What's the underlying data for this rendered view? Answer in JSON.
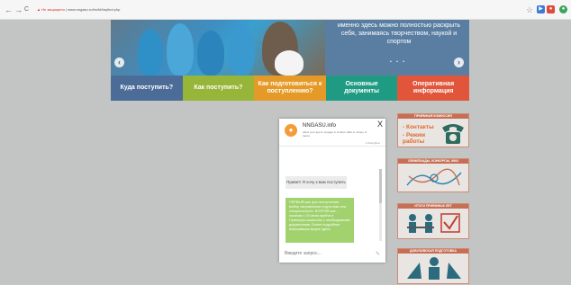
{
  "browser": {
    "back": "←",
    "forward": "→",
    "reload": "C",
    "security_warning": "Не защищено",
    "url": "www.nngasu.ru/bs/bt/faq/bot.php",
    "ext_star": "☆"
  },
  "slider": {
    "caption": "именно здесь можно полностью раскрыть себя, занимаясь творчеством, наукой и спортом",
    "prev": "‹",
    "next": "›",
    "dots": "• • •"
  },
  "tabs": [
    {
      "label": "Куда поступить?",
      "color": "#4b6c96"
    },
    {
      "label": "Как поступить?",
      "color": "#97b539"
    },
    {
      "label": "Как подготовиться к поступлению?",
      "color": "#e59a27"
    },
    {
      "label": "Основные документы",
      "color": "#1f9b84"
    },
    {
      "label": "Оперативная информация",
      "color": "#e1553a"
    }
  ],
  "banners": {
    "b1_title": "ПРИЕМНАЯ КОМИССИЯ",
    "b1_line1": "- Контакты",
    "b1_line2": "- Режим работы",
    "b2_title": "ОЛИМПИАДЫ, КОНКУРСЫ, ЖКИ",
    "b3_title": "ИТОГИ ПРИЕМНЫХ ЛЕТ",
    "b4_title": "ДОВУЗОВСКАЯ ПОДГОТОВКА"
  },
  "chat": {
    "name": "NNGASU.info",
    "description": "Allow your app to engage in smarter talks in variety of topics",
    "close": "X",
    "powered_by": "Dialogflow",
    "user_message": "Привет! Я хочу к вам поступить",
    "bot_message": "ПЕРВЫЙ шаг для поступления - выбор направления подготовки или специальности. ВТОРОЙ шаг - начиная с 20 июня прийти в Приемную комиссию с необходимыми документами. Более подробная информация медле здесь",
    "input_placeholder": "Введите запрос...",
    "send_icon": "✎"
  }
}
